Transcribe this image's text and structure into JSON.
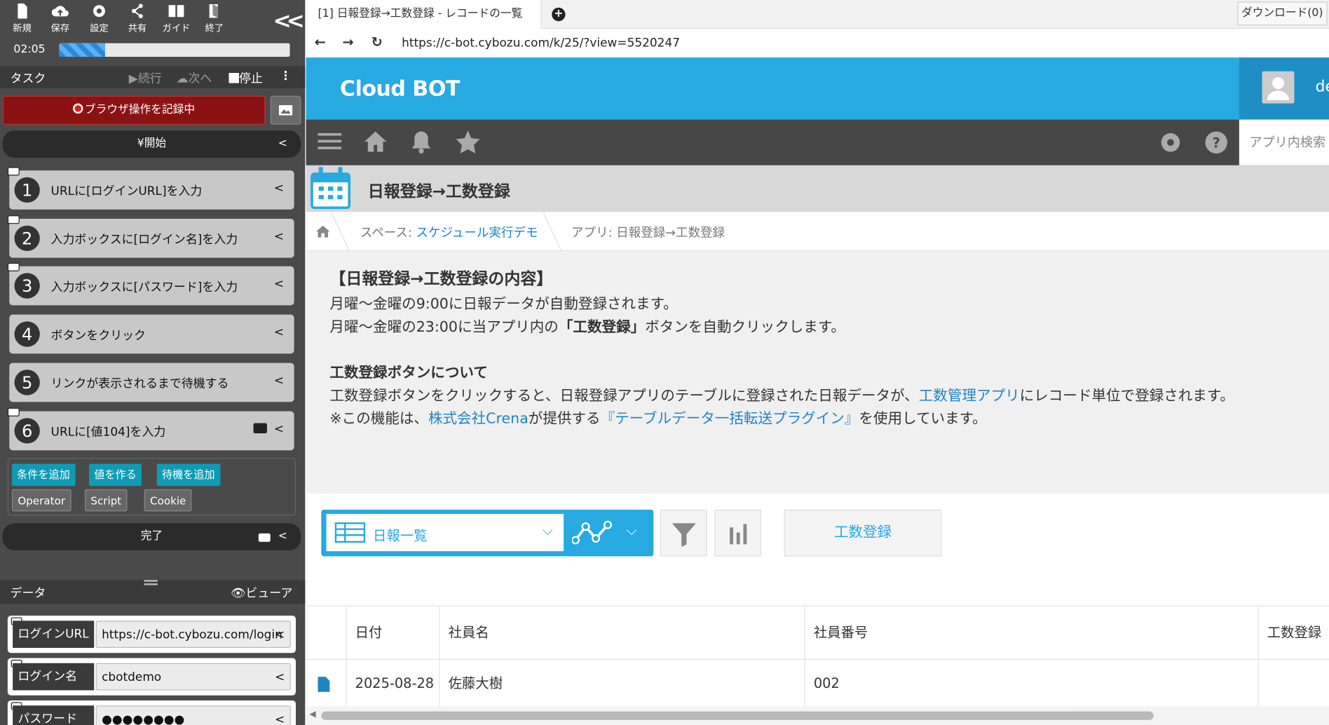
{
  "toolbar": {
    "new": "新規",
    "save": "保存",
    "settings": "設定",
    "share": "共有",
    "guide": "ガイド",
    "exit": "終了"
  },
  "timer": "02:05",
  "progress_fraction": 0.2,
  "task": {
    "label": "タスク",
    "continue": "続行",
    "next": "次へ",
    "stop": "停止"
  },
  "record_label": "ブラウザ操作を記録中",
  "start_label": "開始",
  "steps": [
    {
      "num": "1",
      "label": "URLに[ログインURL]を入力"
    },
    {
      "num": "2",
      "label": "入力ボックスに[ログイン名]を入力"
    },
    {
      "num": "3",
      "label": "入力ボックスに[パスワード]を入力"
    },
    {
      "num": "4",
      "label": "ボタンをクリック"
    },
    {
      "num": "5",
      "label": "リンクが表示されるまで待機する"
    },
    {
      "num": "6",
      "label": "URLに[値104]を入力"
    }
  ],
  "tools": {
    "add_condition": "条件を追加",
    "make_value": "値を作る",
    "add_wait": "待機を追加",
    "operator": "Operator",
    "script": "Script",
    "cookie": "Cookie"
  },
  "finish_label": "完了",
  "data": {
    "label": "データ",
    "viewer": "ビューア",
    "fields": [
      {
        "name": "ログインURL",
        "value": "https://c-bot.cybozu.com/login"
      },
      {
        "name": "ログイン名",
        "value": "cbotdemo"
      },
      {
        "name": "パスワード",
        "value": "●●●●●●●●"
      }
    ]
  },
  "browser": {
    "tab_title": "[1] 日報登録→工数登録 - レコードの一覧",
    "download": "ダウンロード(0)",
    "url": "https://c-bot.cybozu.com/k/25/?view=5520247"
  },
  "app": {
    "logo": "Cloud BOT",
    "user": "de",
    "search_placeholder": "アプリ内検索",
    "title": "日報登録→工数登録",
    "breadcrumb": {
      "space_prefix": "スペース: ",
      "space": "スケジュール実行デモ",
      "app": "アプリ: 日報登録→工数登録"
    },
    "desc": {
      "heading": "【日報登録→工数登録の内容】",
      "line1": "月曜〜金曜の9:00に日報データが自動登録されます。",
      "line2a": "月曜〜金曜の23:00に当アプリ内の",
      "line2b": "「工数登録」",
      "line2c": "ボタンを自動クリックします。",
      "heading2": "工数登録ボタンについて",
      "line3a": "工数登録ボタンをクリックすると、日報登録アプリのテーブルに登録された日報データが、",
      "line3b": "工数管理アプリ",
      "line3c": "にレコード単位で登録されます。",
      "line4a": "※この機能は、",
      "line4b": "株式会社Crena",
      "line4c": "が提供する",
      "line4d": "『テーブルデータ一括転送プラグイン』",
      "line4e": "を使用しています。"
    },
    "view": {
      "selected": "日報一覧",
      "custom_button": "工数登録"
    },
    "table": {
      "headers": [
        "日付",
        "社員名",
        "社員番号",
        "工数登録"
      ],
      "rows": [
        [
          "2025-08-28",
          "佐藤大樹",
          "002",
          ""
        ]
      ]
    }
  },
  "colors": {
    "cybozu_blue": "#27a9e1",
    "record_red": "#8b1212",
    "link": "#1f84c6"
  }
}
